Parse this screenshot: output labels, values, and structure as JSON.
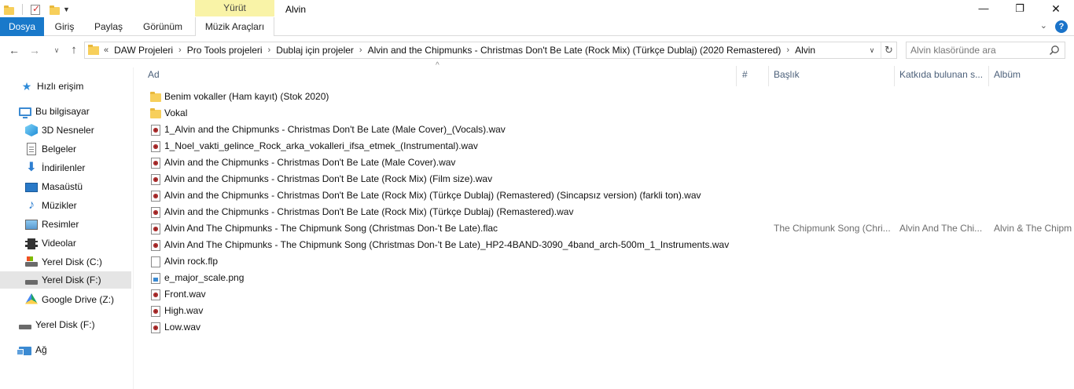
{
  "window": {
    "title": "Alvin",
    "context_tab_group": "Yürüt"
  },
  "ribbon": {
    "tabs": [
      "Dosya",
      "Giriş",
      "Paylaş",
      "Görünüm",
      "Müzik Araçları"
    ]
  },
  "address": {
    "overflow": "«",
    "crumbs": [
      "DAW Projeleri",
      "Pro Tools projeleri",
      "Dublaj için projeler",
      "Alvin and the Chipmunks - Christmas Don't Be Late (Rock Mix) (Türkçe Dublaj) (2020 Remastered)",
      "Alvin"
    ]
  },
  "search": {
    "placeholder": "Alvin klasöründe ara"
  },
  "sidebar": {
    "items": [
      {
        "label": "Hızlı erişim",
        "icon": "star-icon"
      },
      {
        "label": "Bu bilgisayar",
        "icon": "computer-icon"
      },
      {
        "label": "3D Nesneler",
        "icon": "cube-icon"
      },
      {
        "label": "Belgeler",
        "icon": "document-icon"
      },
      {
        "label": "İndirilenler",
        "icon": "download-icon"
      },
      {
        "label": "Masaüstü",
        "icon": "desktop-icon"
      },
      {
        "label": "Müzikler",
        "icon": "music-icon"
      },
      {
        "label": "Resimler",
        "icon": "pictures-icon"
      },
      {
        "label": "Videolar",
        "icon": "video-icon"
      },
      {
        "label": "Yerel Disk (C:)",
        "icon": "windows-disk-icon"
      },
      {
        "label": "Yerel Disk (F:)",
        "icon": "disk-icon",
        "selected": true
      },
      {
        "label": "Google Drive (Z:)",
        "icon": "google-drive-icon"
      },
      {
        "label": "Yerel Disk (F:)",
        "icon": "disk-icon"
      },
      {
        "label": "Ağ",
        "icon": "network-icon"
      }
    ]
  },
  "columns": [
    "Ad",
    "#",
    "Başlık",
    "Katkıda bulunan s...",
    "Albüm"
  ],
  "files": [
    {
      "name": "Benim vokaller (Ham kayıt) (Stok 2020)",
      "type": "folder"
    },
    {
      "name": "Vokal",
      "type": "folder"
    },
    {
      "name": "1_Alvin and the Chipmunks - Christmas Don't Be Late (Male Cover)_(Vocals).wav",
      "type": "audio"
    },
    {
      "name": "1_Noel_vakti_gelince_Rock_arka_vokalleri_ifsa_etmek_(Instrumental).wav",
      "type": "audio"
    },
    {
      "name": "Alvin and the Chipmunks - Christmas Don't Be Late (Male Cover).wav",
      "type": "audio"
    },
    {
      "name": "Alvin and the Chipmunks - Christmas Don't Be Late (Rock Mix) (Film size).wav",
      "type": "audio"
    },
    {
      "name": "Alvin and the Chipmunks - Christmas Don't Be Late (Rock Mix) (Türkçe Dublaj) (Remastered) (Sincapsız version)  (farkli ton).wav",
      "type": "audio"
    },
    {
      "name": "Alvin and the Chipmunks - Christmas Don't Be Late (Rock Mix) (Türkçe Dublaj) (Remastered).wav",
      "type": "audio"
    },
    {
      "name": "Alvin And The Chipmunks - The Chipmunk Song (Christmas Don-'t Be Late).flac",
      "type": "audio",
      "title": "The Chipmunk Song (Chri...",
      "artist": "Alvin And The Chi...",
      "album": "Alvin & The Chipm"
    },
    {
      "name": "Alvin And The Chipmunks - The Chipmunk Song (Christmas Don-'t Be Late)_HP2-4BAND-3090_4band_arch-500m_1_Instruments.wav",
      "type": "audio"
    },
    {
      "name": "Alvin rock.flp",
      "type": "plain"
    },
    {
      "name": "e_major_scale.png",
      "type": "image"
    },
    {
      "name": "Front.wav",
      "type": "audio"
    },
    {
      "name": "High.wav",
      "type": "audio"
    },
    {
      "name": "Low.wav",
      "type": "audio"
    }
  ]
}
